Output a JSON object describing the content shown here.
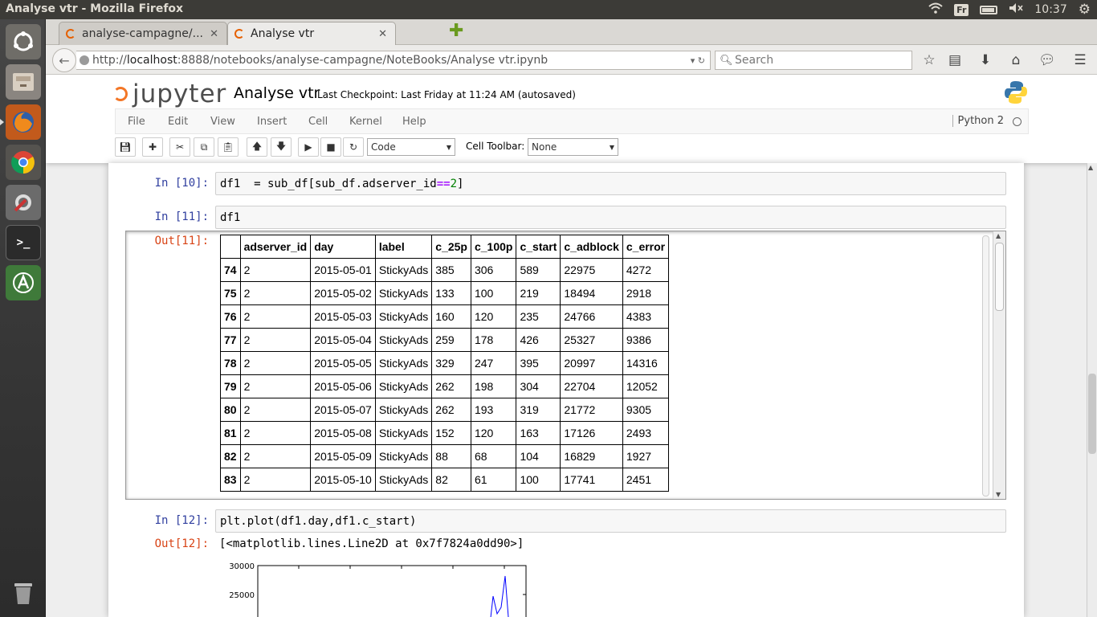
{
  "system": {
    "window_title": "Analyse vtr - Mozilla Firefox",
    "keyboard_layout": "Fr",
    "clock": "10:37"
  },
  "browser": {
    "tabs": [
      {
        "label": "analyse-campagne/..."
      },
      {
        "label": "Analyse vtr"
      }
    ],
    "url_prefix": "http://",
    "url_host": "localhost",
    "url_rest": ":8888/notebooks/analyse-campagne/NoteBooks/Analyse vtr.ipynb",
    "search_placeholder": "Search"
  },
  "jupyter": {
    "logo_text": "jupyter",
    "notebook_name": "Analyse vtr",
    "checkpoint": "Last Checkpoint: Last Friday at 11:24 AM (autosaved)",
    "menu": [
      "File",
      "Edit",
      "View",
      "Insert",
      "Cell",
      "Kernel",
      "Help"
    ],
    "kernel_name": "Python 2",
    "cell_type": "Code",
    "cell_toolbar_label": "Cell Toolbar:",
    "cell_toolbar_value": "None"
  },
  "cells": {
    "c10": {
      "prompt": "In [10]:",
      "code_a": "df1  = sub_df[sub_df.adserver_id",
      "op": "==",
      "lit": "2",
      "code_b": "]"
    },
    "c11": {
      "prompt": "In [11]:",
      "code": "df1",
      "out_prompt": "Out[11]:"
    },
    "c12": {
      "prompt": "In [12]:",
      "code": "plt.plot(df1.day,df1.c_start)",
      "out_prompt": "Out[12]:",
      "out_text": "[<matplotlib.lines.Line2D at 0x7f7824a0dd90>]"
    }
  },
  "table": {
    "columns": [
      "adserver_id",
      "day",
      "label",
      "c_25p",
      "c_100p",
      "c_start",
      "c_adblock",
      "c_error"
    ],
    "rows": [
      [
        "74",
        "2",
        "2015-05-01",
        "StickyAds",
        "385",
        "306",
        "589",
        "22975",
        "4272"
      ],
      [
        "75",
        "2",
        "2015-05-02",
        "StickyAds",
        "133",
        "100",
        "219",
        "18494",
        "2918"
      ],
      [
        "76",
        "2",
        "2015-05-03",
        "StickyAds",
        "160",
        "120",
        "235",
        "24766",
        "4383"
      ],
      [
        "77",
        "2",
        "2015-05-04",
        "StickyAds",
        "259",
        "178",
        "426",
        "25327",
        "9386"
      ],
      [
        "78",
        "2",
        "2015-05-05",
        "StickyAds",
        "329",
        "247",
        "395",
        "20997",
        "14316"
      ],
      [
        "79",
        "2",
        "2015-05-06",
        "StickyAds",
        "262",
        "198",
        "304",
        "22704",
        "12052"
      ],
      [
        "80",
        "2",
        "2015-05-07",
        "StickyAds",
        "262",
        "193",
        "319",
        "21772",
        "9305"
      ],
      [
        "81",
        "2",
        "2015-05-08",
        "StickyAds",
        "152",
        "120",
        "163",
        "17126",
        "2493"
      ],
      [
        "82",
        "2",
        "2015-05-09",
        "StickyAds",
        "88",
        "68",
        "104",
        "16829",
        "1927"
      ],
      [
        "83",
        "2",
        "2015-05-10",
        "StickyAds",
        "82",
        "61",
        "100",
        "17741",
        "2451"
      ]
    ]
  },
  "plot": {
    "ytick_top": "30000",
    "ytick_next": "25000",
    "line_color": "#0000ff"
  }
}
